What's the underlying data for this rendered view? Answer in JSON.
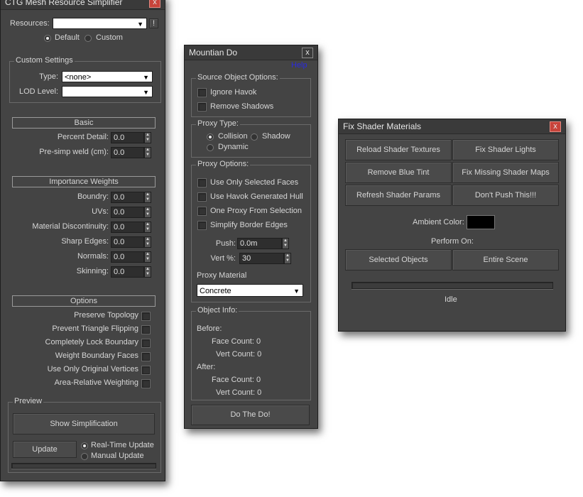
{
  "simplifier": {
    "title": "CTG Mesh Resource Simplifier",
    "close": "x",
    "resources_label": "Resources:",
    "resources_value": "",
    "resources_btn": "!",
    "radio_default": "Default",
    "radio_custom": "Custom",
    "custom_settings_title": "Custom Settings",
    "type_label": "Type:",
    "type_value": "<none>",
    "lod_label": "LOD Level:",
    "lod_value": "",
    "basic_header": "Basic",
    "percent_detail_label": "Percent Detail:",
    "percent_detail_value": "0.0",
    "preweld_label": "Pre-simp weld (cm):",
    "preweld_value": "0.0",
    "importance_header": "Importance Weights",
    "weights": [
      {
        "label": "Boundry:",
        "value": "0.0"
      },
      {
        "label": "UVs:",
        "value": "0.0"
      },
      {
        "label": "Material Discontinuity:",
        "value": "0.0"
      },
      {
        "label": "Sharp Edges:",
        "value": "0.0"
      },
      {
        "label": "Normals:",
        "value": "0.0"
      },
      {
        "label": "Skinning:",
        "value": "0.0"
      }
    ],
    "options_header": "Options",
    "options": [
      "Preserve Topology",
      "Prevent Triangle Flipping",
      "Completely Lock Boundary",
      "Weight Boundary Faces",
      "Use Only Original Vertices",
      "Area-Relative Weighting"
    ],
    "preview_title": "Preview",
    "show_simplification": "Show Simplification",
    "update": "Update",
    "realtime_update": "Real-Time Update",
    "manual_update": "Manual Update"
  },
  "mountian": {
    "title": "Mountian Do",
    "close": "x",
    "help": "Help",
    "source_title": "Source Object Options:",
    "ignore_havok": "Ignore Havok",
    "remove_shadows": "Remove Shadows",
    "proxy_type_title": "Proxy Type:",
    "collision": "Collision",
    "shadow": "Shadow",
    "dynamic": "Dynamic",
    "proxy_options_title": "Proxy Options:",
    "use_only_selected": "Use Only Selected Faces",
    "use_havok_hull": "Use Havok Generated Hull",
    "one_proxy": "One Proxy From Selection",
    "simplify_border": "Simplify Border Edges",
    "push_label": "Push:",
    "push_value": "0.0m",
    "vert_label": "Vert %:",
    "vert_value": "30",
    "proxy_material_label": "Proxy Material",
    "proxy_material_value": "Concrete",
    "object_info_title": "Object Info:",
    "before": "Before:",
    "after": "After:",
    "before_face": "Face Count: 0",
    "before_vert": "Vert Count: 0",
    "after_face": "Face Count: 0",
    "after_vert": "Vert Count: 0",
    "do_button": "Do The Do!"
  },
  "fixshader": {
    "title": "Fix Shader Materials",
    "close": "x",
    "buttons": [
      "Reload Shader Textures",
      "Fix Shader Lights",
      "Remove Blue Tint",
      "Fix Missing Shader Maps",
      "Refresh Shader Params",
      "Don't Push This!!!"
    ],
    "ambient_label": "Ambient Color:",
    "ambient_color": "#000000",
    "perform_on": "Perform On:",
    "selected_objects": "Selected Objects",
    "entire_scene": "Entire Scene",
    "progress": 0,
    "status": "Idle"
  }
}
